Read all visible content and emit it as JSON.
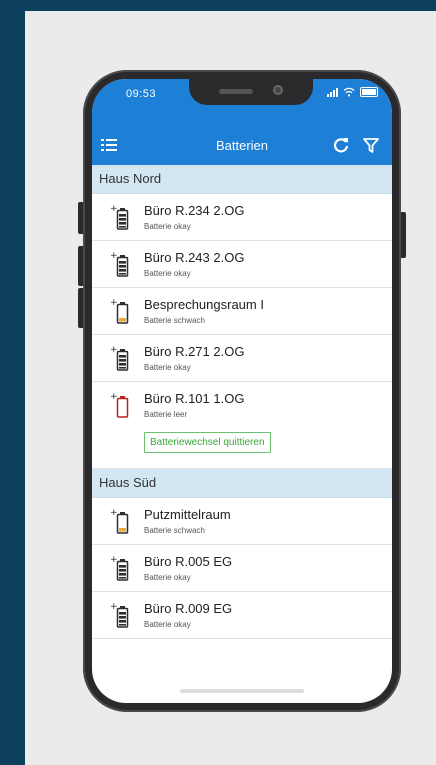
{
  "status_bar": {
    "time": "09:53"
  },
  "app_bar": {
    "title": "Batterien"
  },
  "colors": {
    "accent": "#1e7fd6",
    "ok": "#2e2e2e",
    "low": "#f0a830",
    "empty": "#c02020",
    "action": "#38a838"
  },
  "sections": [
    {
      "title": "Haus Nord",
      "items": [
        {
          "name": "Büro R.234 2.OG",
          "status": "Batterie okay",
          "level": "full"
        },
        {
          "name": "Büro R.243 2.OG",
          "status": "Batterie okay",
          "level": "full"
        },
        {
          "name": "Besprechungsraum I",
          "status": "Batterie schwach",
          "level": "low"
        },
        {
          "name": "Büro R.271 2.OG",
          "status": "Batterie okay",
          "level": "full"
        },
        {
          "name": "Büro R.101 1.OG",
          "status": "Batterie leer",
          "level": "empty",
          "action": "Batteriewechsel quittieren"
        }
      ]
    },
    {
      "title": "Haus Süd",
      "items": [
        {
          "name": "Putzmittelraum",
          "status": "Batterie schwach",
          "level": "low"
        },
        {
          "name": "Büro R.005 EG",
          "status": "Batterie okay",
          "level": "full"
        },
        {
          "name": "Büro R.009 EG",
          "status": "Batterie okay",
          "level": "full"
        }
      ]
    }
  ]
}
